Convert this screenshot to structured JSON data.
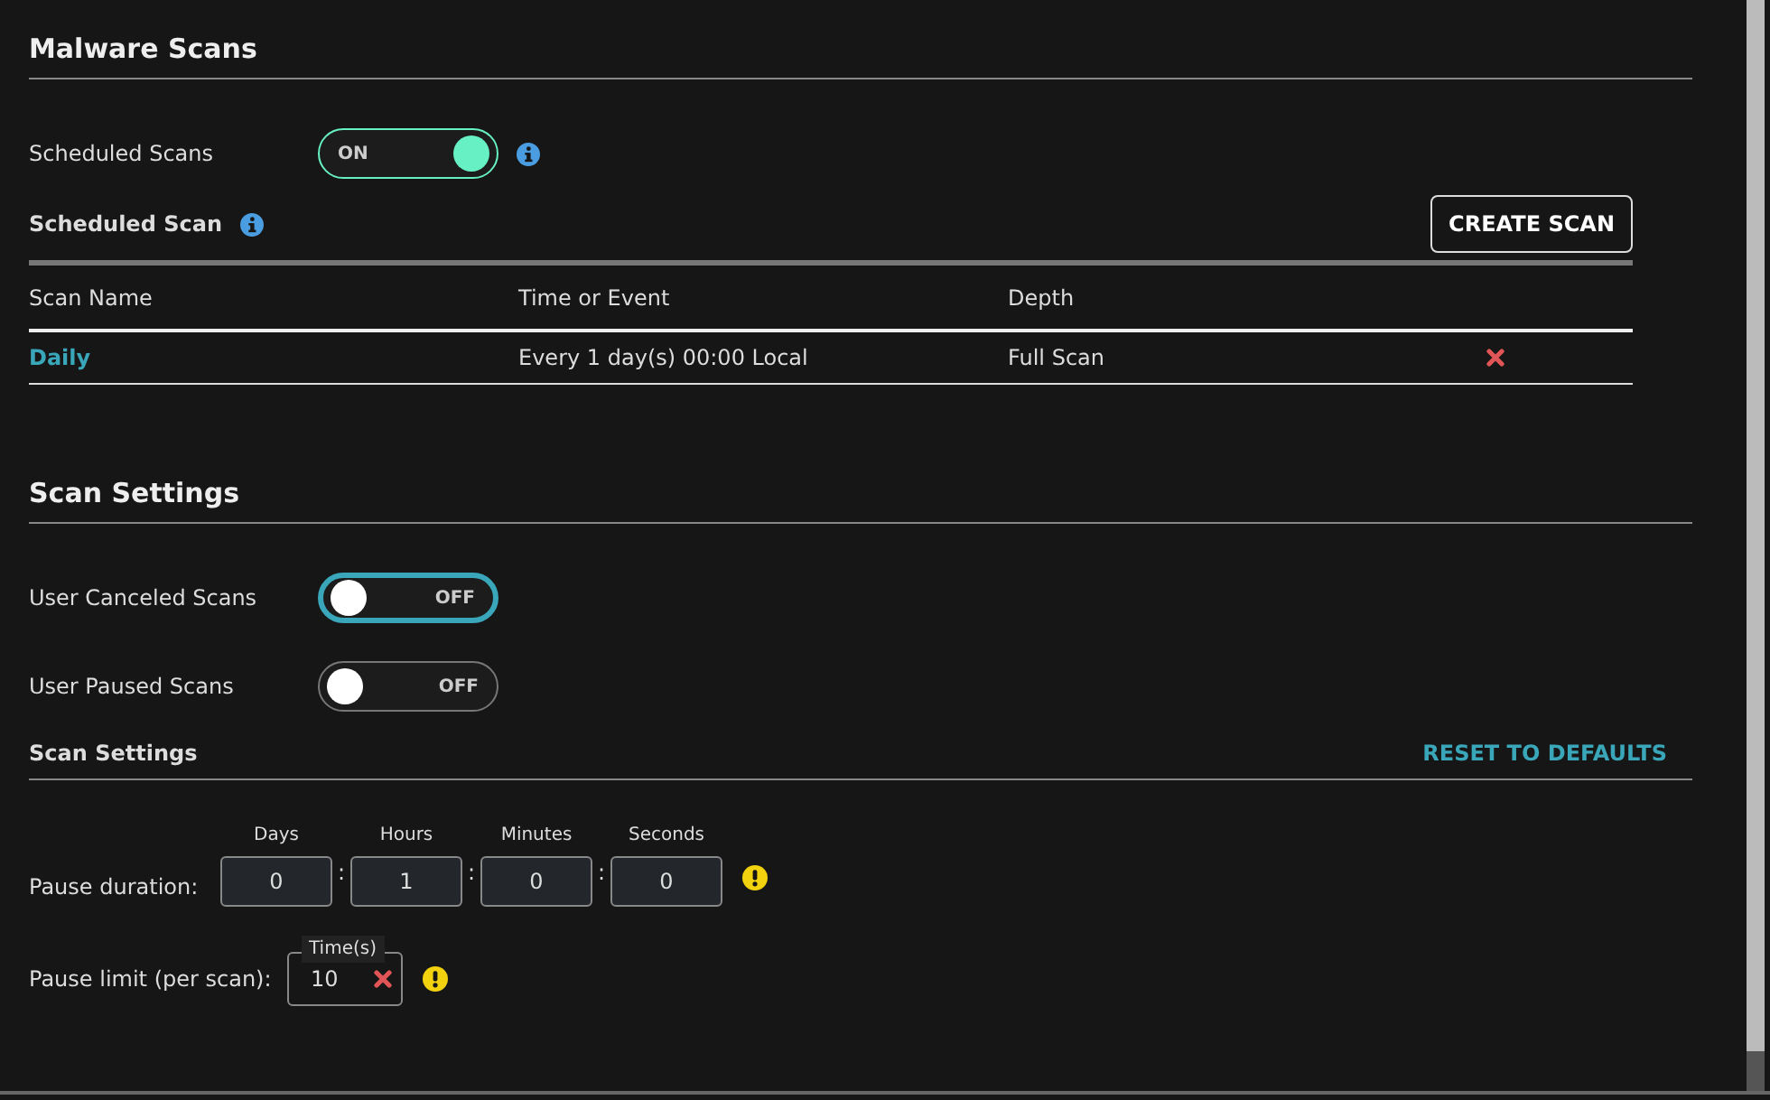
{
  "malware_scans": {
    "title": "Malware Scans",
    "scheduled_scans": {
      "label": "Scheduled Scans",
      "on": true,
      "focused": false,
      "state_text": "ON"
    },
    "scheduled_scan": {
      "title": "Scheduled Scan",
      "button": "CREATE SCAN",
      "table": {
        "columns": [
          "Scan Name",
          "Time or Event",
          "Depth"
        ],
        "rows": [
          {
            "name": "Daily",
            "time": "Every 1 day(s) 00:00 Local",
            "depth": "Full Scan"
          }
        ]
      }
    }
  },
  "scan_settings": {
    "title": "Scan Settings",
    "toggles": [
      {
        "label": "User Canceled Scans",
        "on": false,
        "focused": true,
        "state_text": "OFF"
      },
      {
        "label": "User Paused Scans",
        "on": false,
        "focused": false,
        "state_text": "OFF"
      }
    ],
    "subsection": {
      "title": "Scan Settings",
      "reset": "RESET TO DEFAULTS",
      "pause_duration": {
        "label": "Pause duration:",
        "fields": [
          {
            "label": "Days",
            "value": "0",
            "separator_after": ":"
          },
          {
            "label": "Hours",
            "value": "1",
            "separator_after": ":"
          },
          {
            "label": "Minutes",
            "value": "0",
            "separator_after": ":"
          },
          {
            "label": "Seconds",
            "value": "0"
          }
        ]
      },
      "pause_limit": {
        "label": "Pause limit (per scan):",
        "field_label": "Time(s)",
        "value": "10"
      }
    }
  }
}
